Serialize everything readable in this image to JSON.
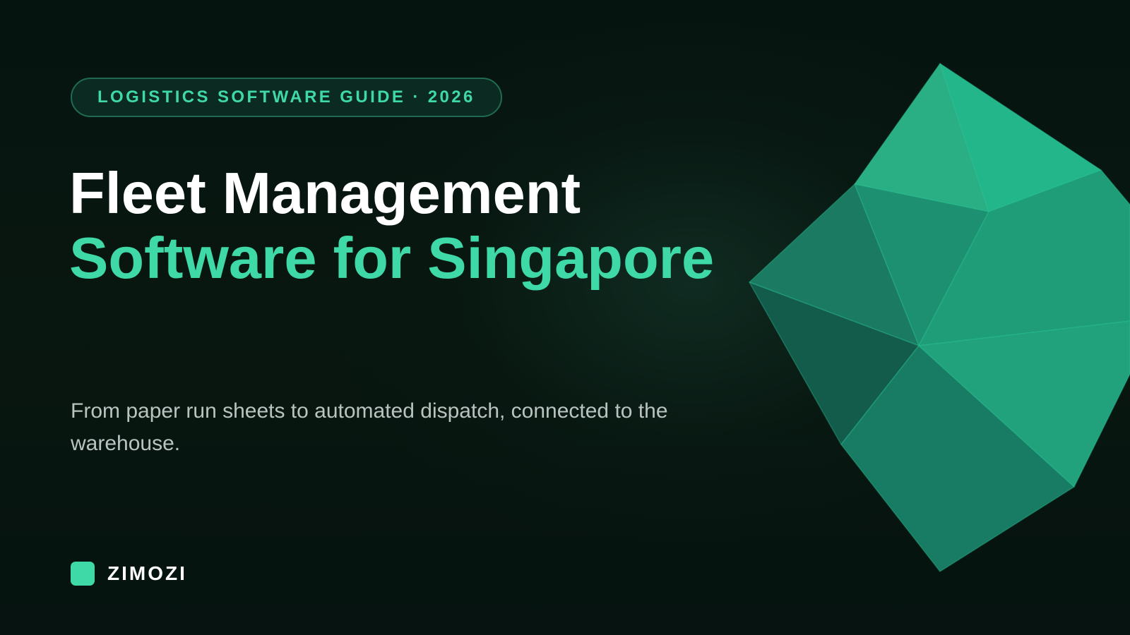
{
  "badge": {
    "text": "LOGISTICS SOFTWARE GUIDE · 2026"
  },
  "headline": {
    "line1": "Fleet Management",
    "line2": "Software for Singapore"
  },
  "subtitle": "From paper run sheets to automated dispatch, connected to the warehouse.",
  "brand": {
    "name": "ZIMOZI",
    "logo_icon": "rounded-square-logo"
  },
  "colors": {
    "background": "#071510",
    "accent": "#3ed9a6",
    "headline_primary": "#ffffff",
    "subtitle": "#b9c4c0",
    "badge_border": "#1f6b52",
    "badge_fill": "#0b2a21"
  },
  "decoration": {
    "name": "low-poly-gem-graphic",
    "facet_colors": [
      "#2aaf85",
      "#22b68a",
      "#1c9070",
      "#1b7a62",
      "#1e9d78",
      "#135c4b",
      "#177c63",
      "#21a27d"
    ]
  }
}
